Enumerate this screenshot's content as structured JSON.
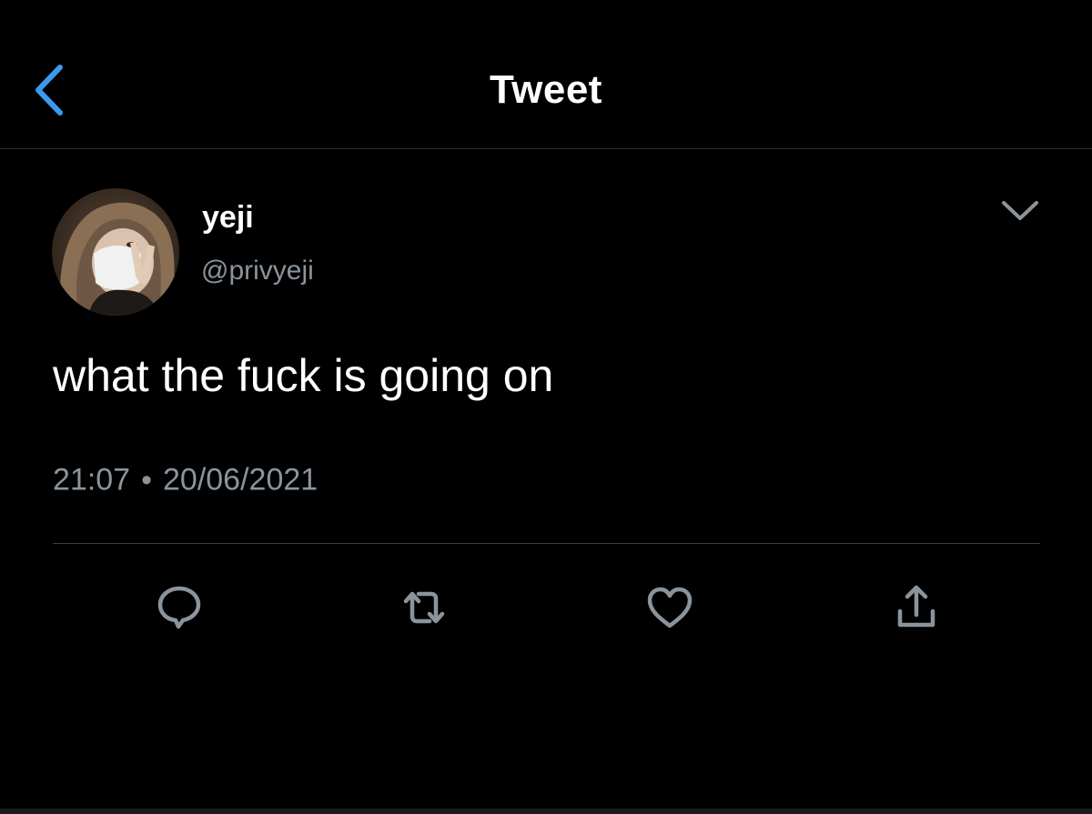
{
  "header": {
    "title": "Tweet",
    "back_icon": "chevron-left-icon"
  },
  "tweet": {
    "author": {
      "display_name": "yeji",
      "handle": "@privyeji"
    },
    "text": "what the fuck is going on",
    "time": "21:07",
    "separator": "•",
    "date": "20/06/2021",
    "menu_icon": "chevron-down-icon"
  },
  "actions": [
    {
      "name": "reply",
      "icon": "reply-icon"
    },
    {
      "name": "retweet",
      "icon": "retweet-icon"
    },
    {
      "name": "like",
      "icon": "heart-icon"
    },
    {
      "name": "share",
      "icon": "share-icon"
    }
  ],
  "colors": {
    "background": "#000000",
    "accent": "#1d9bf0",
    "text_primary": "#ffffff",
    "text_secondary": "#8b949c",
    "icon": "#8b949c",
    "divider": "#2b2f33"
  }
}
